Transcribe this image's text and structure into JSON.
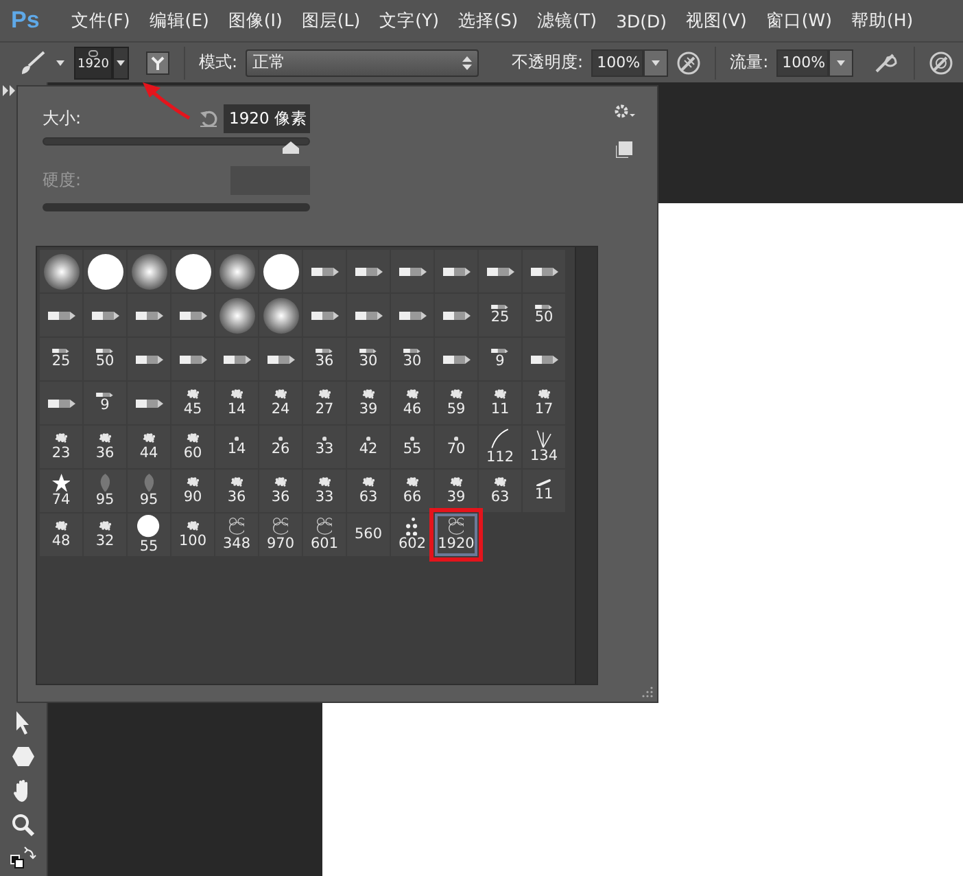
{
  "app": {
    "logo": "Ps"
  },
  "menu": [
    "文件(F)",
    "编辑(E)",
    "图像(I)",
    "图层(L)",
    "文字(Y)",
    "选择(S)",
    "滤镜(T)",
    "3D(D)",
    "视图(V)",
    "窗口(W)",
    "帮助(H)"
  ],
  "options_bar": {
    "preset_size": "1920",
    "mode_label": "模式:",
    "mode_value": "正常",
    "opacity_label": "不透明度:",
    "opacity_value": "100%",
    "flow_label": "流量:",
    "flow_value": "100%"
  },
  "panel": {
    "size": {
      "label": "大小:",
      "value": "1920 像素",
      "level": 0.93
    },
    "hardness": {
      "label": "硬度:",
      "disabled": true
    }
  },
  "brushes": [
    {
      "kind": "soft",
      "selected": false
    },
    {
      "kind": "hard",
      "selected": false
    },
    {
      "kind": "soft",
      "selected": false
    },
    {
      "kind": "hard",
      "selected": false
    },
    {
      "kind": "soft",
      "selected": false
    },
    {
      "kind": "hard",
      "selected": false
    },
    {
      "kind": "tip",
      "selected": false
    },
    {
      "kind": "tip",
      "selected": false
    },
    {
      "kind": "tip",
      "selected": false
    },
    {
      "kind": "tip",
      "selected": false
    },
    {
      "kind": "tip",
      "selected": false
    },
    {
      "kind": "tip",
      "selected": false
    },
    {
      "kind": "tip",
      "selected": false
    },
    {
      "kind": "tip",
      "selected": false
    },
    {
      "kind": "tip",
      "selected": false
    },
    {
      "kind": "tip",
      "selected": false
    },
    {
      "kind": "soft",
      "selected": false
    },
    {
      "kind": "soft",
      "selected": false
    },
    {
      "kind": "tip",
      "selected": false
    },
    {
      "kind": "tip",
      "selected": false
    },
    {
      "kind": "tip",
      "selected": false
    },
    {
      "kind": "tip",
      "selected": false
    },
    {
      "kind": "tip",
      "size": "25",
      "selected": false
    },
    {
      "kind": "tip",
      "size": "50",
      "selected": false
    },
    {
      "kind": "tip",
      "size": "25",
      "selected": false
    },
    {
      "kind": "tip",
      "size": "50",
      "selected": false
    },
    {
      "kind": "tip",
      "selected": false
    },
    {
      "kind": "tip",
      "selected": false
    },
    {
      "kind": "tip",
      "selected": false
    },
    {
      "kind": "tip",
      "selected": false
    },
    {
      "kind": "tip",
      "size": "36",
      "selected": false
    },
    {
      "kind": "tip",
      "size": "30",
      "selected": false
    },
    {
      "kind": "tip",
      "size": "30",
      "selected": false
    },
    {
      "kind": "tip",
      "selected": false
    },
    {
      "kind": "tip",
      "size": "9",
      "selected": false
    },
    {
      "kind": "tip",
      "selected": false
    },
    {
      "kind": "tip",
      "selected": false
    },
    {
      "kind": "tip",
      "size": "9",
      "selected": false
    },
    {
      "kind": "tip",
      "selected": false
    },
    {
      "kind": "spatter",
      "size": "45",
      "selected": false
    },
    {
      "kind": "spatter",
      "size": "14",
      "selected": false
    },
    {
      "kind": "spatter",
      "size": "24",
      "selected": false
    },
    {
      "kind": "spatter",
      "size": "27",
      "selected": false
    },
    {
      "kind": "spatter",
      "size": "39",
      "selected": false
    },
    {
      "kind": "spatter",
      "size": "46",
      "selected": false
    },
    {
      "kind": "spatter",
      "size": "59",
      "selected": false
    },
    {
      "kind": "spatter",
      "size": "11",
      "selected": false
    },
    {
      "kind": "spatter",
      "size": "17",
      "selected": false
    },
    {
      "kind": "spatter",
      "size": "23",
      "selected": false
    },
    {
      "kind": "spatter",
      "size": "36",
      "selected": false
    },
    {
      "kind": "spatter",
      "size": "44",
      "selected": false
    },
    {
      "kind": "spatter",
      "size": "60",
      "selected": false
    },
    {
      "kind": "point",
      "size": "14",
      "selected": false
    },
    {
      "kind": "point",
      "size": "26",
      "selected": false
    },
    {
      "kind": "point",
      "size": "33",
      "selected": false
    },
    {
      "kind": "point",
      "size": "42",
      "selected": false
    },
    {
      "kind": "point",
      "size": "55",
      "selected": false
    },
    {
      "kind": "point",
      "size": "70",
      "selected": false
    },
    {
      "kind": "curve",
      "size": "112",
      "selected": false
    },
    {
      "kind": "grass",
      "size": "134",
      "selected": false
    },
    {
      "kind": "star",
      "size": "74",
      "selected": false
    },
    {
      "kind": "petal",
      "size": "95",
      "selected": false
    },
    {
      "kind": "petal",
      "size": "95",
      "selected": false
    },
    {
      "kind": "spatter",
      "size": "90",
      "selected": false
    },
    {
      "kind": "spatter",
      "size": "36",
      "selected": false
    },
    {
      "kind": "spatter",
      "size": "36",
      "selected": false
    },
    {
      "kind": "spatter",
      "size": "33",
      "selected": false
    },
    {
      "kind": "spatter",
      "size": "63",
      "selected": false
    },
    {
      "kind": "spatter",
      "size": "66",
      "selected": false
    },
    {
      "kind": "spatter",
      "size": "39",
      "selected": false
    },
    {
      "kind": "spatter",
      "size": "63",
      "selected": false
    },
    {
      "kind": "stroke",
      "size": "11",
      "selected": false
    },
    {
      "kind": "spatter",
      "size": "48",
      "selected": false
    },
    {
      "kind": "spatter",
      "size": "32",
      "selected": false
    },
    {
      "kind": "hard",
      "size": "55",
      "selected": false
    },
    {
      "kind": "spatter",
      "size": "100",
      "selected": false
    },
    {
      "kind": "outline",
      "size": "348",
      "selected": false
    },
    {
      "kind": "outline",
      "size": "970",
      "selected": false
    },
    {
      "kind": "outline",
      "size": "601",
      "selected": false
    },
    {
      "kind": "blank",
      "size": "560",
      "selected": false
    },
    {
      "kind": "dots",
      "size": "602",
      "selected": false
    },
    {
      "kind": "outline",
      "size": "1920",
      "selected": true
    }
  ]
}
